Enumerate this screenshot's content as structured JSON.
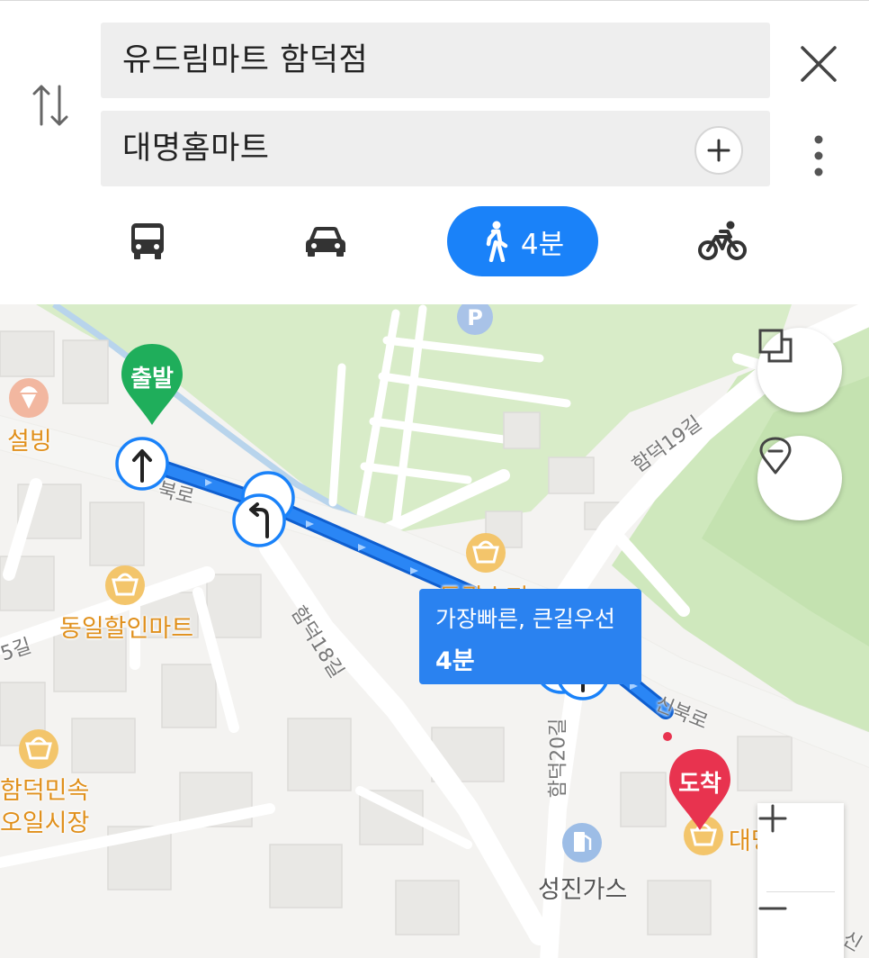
{
  "search": {
    "origin": "유드림마트 함덕점",
    "destination": "대명홈마트"
  },
  "modes": {
    "walk_time": "4분"
  },
  "map": {
    "start_marker": "출발",
    "end_marker": "도착",
    "route_card": {
      "description": "가장빠른, 큰길우선",
      "time": "4분"
    },
    "pois": {
      "seolbing": "설빙",
      "dongil_mart": "동일할인마트",
      "hamdeok_market_line1": "함덕민속",
      "hamdeok_market_line2": "오일시장",
      "donggwang_super": "동광슈퍼",
      "gas_station": "성진가스",
      "daemyeong_partial": "대명"
    },
    "streets": {
      "bukro_partial": "북로",
      "hamdeok18": "함덕18길",
      "hamdeok19": "함덕19길",
      "hamdeok20": "함덕20길",
      "sinbukro": "신북로",
      "left_partial": "5길",
      "bottom_right_partial": "신"
    }
  },
  "colors": {
    "accent": "#1a82f9",
    "route": "#1e78f0",
    "start_marker": "#1fae5b",
    "end_marker": "#e8334f",
    "poi": "#f0a830",
    "park": "#d5ecc2"
  },
  "icons": {
    "swap": "swap-vertical-icon",
    "close": "close-icon",
    "more": "more-vertical-icon",
    "add_stop": "plus-icon",
    "bus": "bus-icon",
    "car": "car-icon",
    "walk": "walk-icon",
    "bike": "bicycle-icon",
    "layers": "layers-icon",
    "location": "location-pin-icon",
    "zoom_in": "plus-icon",
    "zoom_out": "minus-icon"
  }
}
